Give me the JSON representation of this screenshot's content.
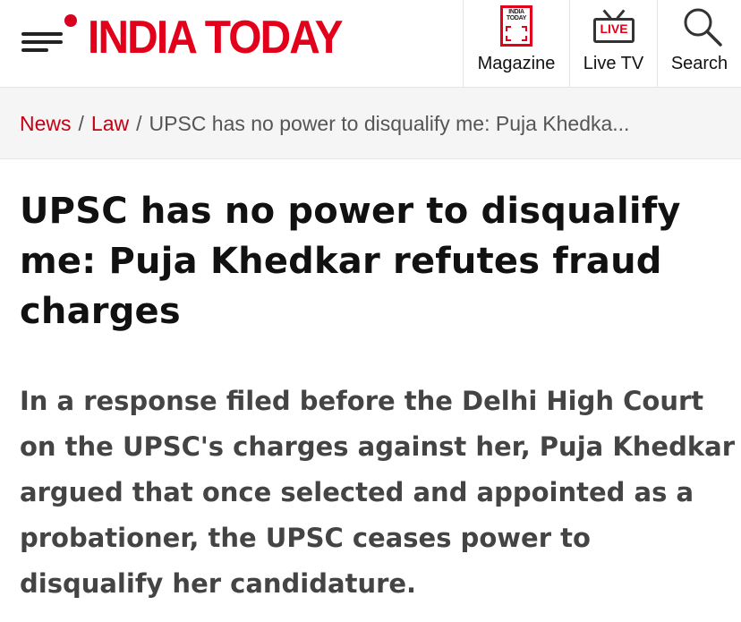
{
  "header": {
    "logo_text": "INDIA TODAY",
    "nav": {
      "magazine_label": "Magazine",
      "magazine_icon_text": "INDIA TODAY",
      "livetv_label": "Live TV",
      "livetv_icon_text": "LIVE",
      "search_label": "Search"
    }
  },
  "breadcrumb": {
    "items": [
      "News",
      "Law"
    ],
    "separator": "/",
    "current": "UPSC has no power to disqualify me: Puja Khedka..."
  },
  "article": {
    "headline": "UPSC has no power to disqualify me: Puja Khedkar refutes fraud charges",
    "summary": "In a response filed before the Delhi High Court on the UPSC's charges against her, Puja Khedkar argued that once selected and appointed as a probationer, the UPSC ceases power to disqualify her candidature."
  },
  "colors": {
    "brand_red": "#e2001a",
    "breadcrumb_link": "#c40014",
    "breadcrumb_bg": "#f5f5f5"
  },
  "icons": [
    "menu-icon",
    "magazine-icon",
    "live-tv-icon",
    "search-icon"
  ]
}
